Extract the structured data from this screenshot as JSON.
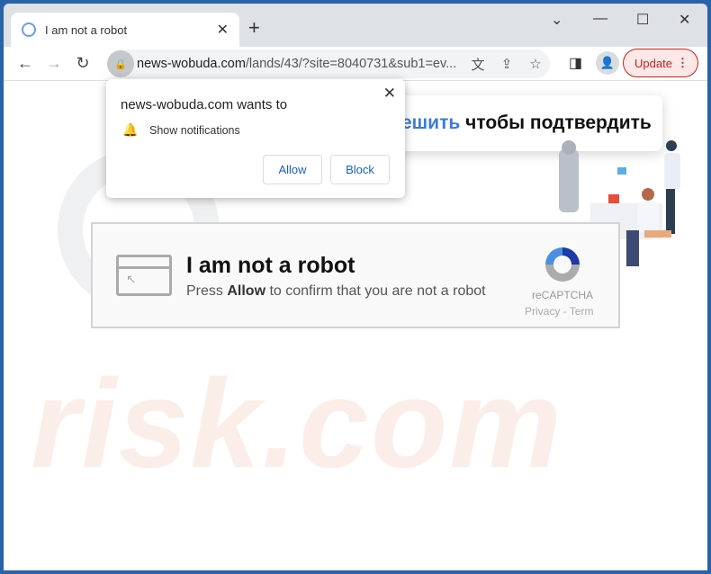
{
  "browser": {
    "tab_title": "I am not a robot",
    "url_domain": "news-wobuda.com",
    "url_path": "/lands/43/?site=8040731&sub1=ev...",
    "update_label": "Update"
  },
  "popup": {
    "title": "news-wobuda.com wants to",
    "permission": "Show notifications",
    "allow_label": "Allow",
    "block_label": "Block"
  },
  "page": {
    "banner_blue": "ешить",
    "banner_text": " чтобы подтвердить",
    "captcha": {
      "title": "I am not a robot",
      "sub_pre": "Press ",
      "sub_bold": "Allow",
      "sub_post": " to confirm that you are not a robot",
      "brand": "reCAPTCHA",
      "links": "Privacy - Term"
    },
    "watermark": "risk.com"
  },
  "colors": {
    "accent": "#1a5fc7",
    "update": "#c5221f",
    "banner_blue": "#3b7bd9"
  }
}
